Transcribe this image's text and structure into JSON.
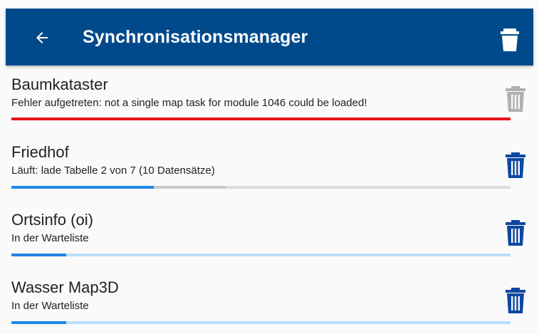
{
  "appbar": {
    "title": "Synchronisationsmanager",
    "back_icon": "arrow-left-icon",
    "action_icon": "trash-icon",
    "background": "#004a8c"
  },
  "jobs": [
    {
      "name": "Baumkataster",
      "status": "Fehler aufgetreten: not a single map task for module 1046 could be loaded!",
      "state": "error",
      "progress": 1.0,
      "secondary_progress": 0,
      "bar_color": "#e8141b",
      "track_color": "#e8141b",
      "delete_enabled": false
    },
    {
      "name": "Friedhof",
      "status": "Läuft: lade Tabelle 2 von 7 (10 Datensätze)",
      "state": "running",
      "progress": 0.285,
      "secondary_progress": 0.43,
      "bar_color": "#1e88e5",
      "track_color": "#dddddd",
      "delete_enabled": true
    },
    {
      "name": "Ortsinfo (oi)",
      "status": "In der Warteliste",
      "state": "queued",
      "progress": 0.11,
      "secondary_progress": 0,
      "bar_color": "#1e88e5",
      "track_color": "#bbdefb",
      "delete_enabled": true
    },
    {
      "name": "Wasser Map3D",
      "status": "In der Warteliste",
      "state": "queued",
      "progress": 0.11,
      "secondary_progress": 0,
      "bar_color": "#1e88e5",
      "track_color": "#bbdefb",
      "delete_enabled": true
    }
  ],
  "colors": {
    "trash_enabled": "#0d47a1",
    "trash_disabled": "#b0b0b0"
  }
}
